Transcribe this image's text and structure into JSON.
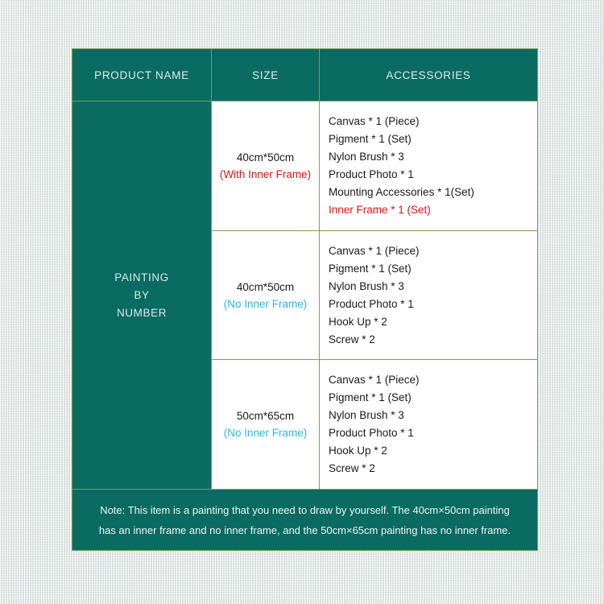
{
  "colors": {
    "teal": "#0a6b62",
    "border_green": "#7d9e4f",
    "red": "#ee1111",
    "cyan": "#24bcee",
    "header_text": "#ddeeeb",
    "body_text": "#1a1a1a",
    "backdrop": "#e9efed"
  },
  "table": {
    "headers": {
      "product": "PRODUCT NAME",
      "size": "SIZE",
      "accessories": "ACCESSORIES"
    },
    "product_name_lines": [
      "PAINTING",
      "BY",
      "NUMBER"
    ],
    "rows": [
      {
        "size": "40cm*50cm",
        "frame_note": "(With Inner Frame)",
        "frame_note_style": "with-frame",
        "accessories": [
          {
            "text": "Canvas * 1 (Piece)",
            "highlight": false
          },
          {
            "text": "Pigment * 1 (Set)",
            "highlight": false
          },
          {
            "text": "Nylon Brush * 3",
            "highlight": false
          },
          {
            "text": "Product Photo * 1",
            "highlight": false
          },
          {
            "text": "Mounting Accessories * 1(Set)",
            "highlight": false
          },
          {
            "text": "Inner Frame * 1 (Set)",
            "highlight": true
          }
        ]
      },
      {
        "size": "40cm*50cm",
        "frame_note": "(No Inner Frame)",
        "frame_note_style": "no-frame",
        "accessories": [
          {
            "text": "Canvas * 1 (Piece)",
            "highlight": false
          },
          {
            "text": "Pigment * 1 (Set)",
            "highlight": false
          },
          {
            "text": "Nylon Brush * 3",
            "highlight": false
          },
          {
            "text": "Product Photo * 1",
            "highlight": false
          },
          {
            "text": "Hook Up * 2",
            "highlight": false
          },
          {
            "text": "Screw * 2",
            "highlight": false
          }
        ]
      },
      {
        "size": "50cm*65cm",
        "frame_note": "(No Inner Frame)",
        "frame_note_style": "no-frame",
        "accessories": [
          {
            "text": "Canvas * 1 (Piece)",
            "highlight": false
          },
          {
            "text": "Pigment * 1 (Set)",
            "highlight": false
          },
          {
            "text": "Nylon Brush * 3",
            "highlight": false
          },
          {
            "text": "Product Photo * 1",
            "highlight": false
          },
          {
            "text": "Hook Up * 2",
            "highlight": false
          },
          {
            "text": "Screw * 2",
            "highlight": false
          }
        ]
      }
    ]
  },
  "note": {
    "line1": "Note: This item is a painting that you need to draw by yourself. The 40cm×50cm painting",
    "line2": "has an inner frame and no inner frame, and the 50cm×65cm painting has no inner frame."
  }
}
